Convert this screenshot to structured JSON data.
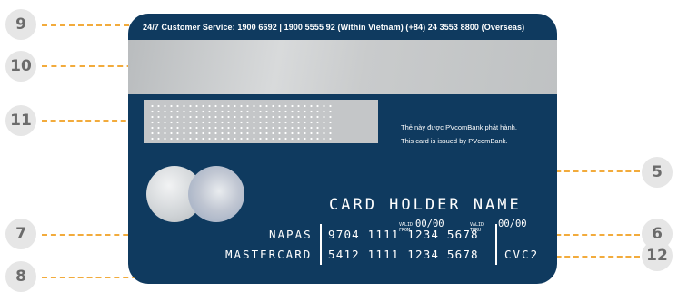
{
  "callouts": [
    "9",
    "10",
    "11",
    "5",
    "6",
    "7",
    "12",
    "8"
  ],
  "card": {
    "service_line": "24/7 Customer Service: 1900 6692  |  1900 5555 92 (Within Vietnam)   (+84) 24 3553 8800 (Overseas)",
    "issued_vi": "Thẻ này được PVcomBank phát hành.",
    "issued_en": "This card is issued by PVcomBank.",
    "holder_name": "CARD HOLDER NAME",
    "valid_from_label_1": "VALID",
    "valid_from_label_2": "FROM",
    "valid_from_value": "00/00",
    "valid_thru_label_1": "VALID",
    "valid_thru_label_2": "THRU",
    "valid_thru_value": "00/00",
    "napas_label": "NAPAS",
    "napas_number": "9704 1111 1234 5678",
    "mastercard_label": "MASTERCARD",
    "mastercard_number": "5412 1111 1234 5678",
    "cvc_label": "CVC2"
  },
  "colors": {
    "card": "#0f3a5f",
    "leader": "#f2ab3c",
    "badge": "#e6e6e6"
  }
}
